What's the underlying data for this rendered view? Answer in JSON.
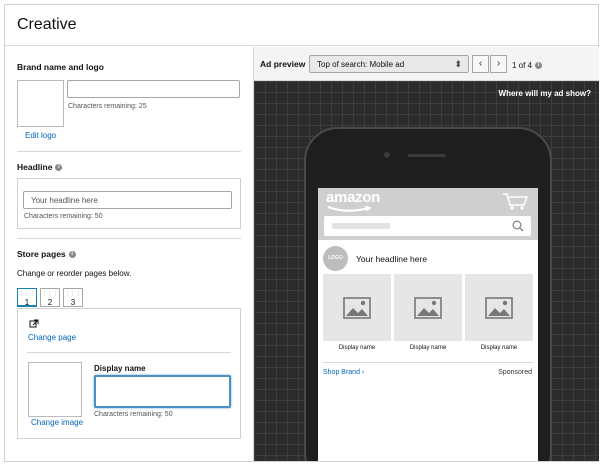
{
  "header": {
    "title": "Creative"
  },
  "brand": {
    "heading": "Brand name and logo",
    "chars_remaining": "Characters remaining: 25",
    "edit_logo": "Edit logo"
  },
  "headline": {
    "heading": "Headline",
    "placeholder": "Your headline here",
    "chars_remaining": "Characters remaining: 50"
  },
  "store_pages": {
    "heading": "Store pages",
    "subtitle": "Change or reorder pages below.",
    "tabs": [
      "1",
      "2",
      "3"
    ],
    "change_page": "Change page",
    "display_name_label": "Display name",
    "change_image": "Change image",
    "chars_remaining": "Characters remaining: 50"
  },
  "preview": {
    "label": "Ad preview",
    "selected_placement": "Top of search: Mobile ad",
    "page_indicator": "1 of 4",
    "where_show": "Where will my ad show?",
    "logo_text": "LOGO",
    "headline": "Your headline here",
    "tile_caption": "Display name",
    "shop_brand": "Shop Brand ›",
    "sponsored": "Sponsored",
    "amazon_text": "amazon"
  }
}
